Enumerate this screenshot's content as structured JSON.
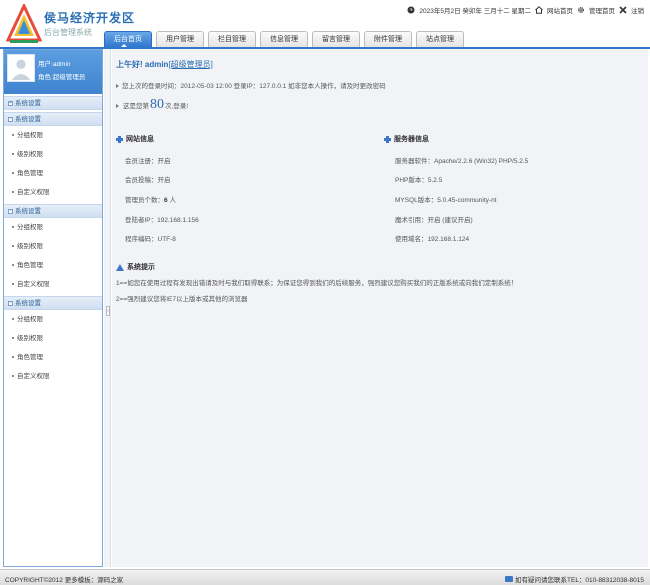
{
  "header": {
    "logo_title": "侯马经济开发区",
    "logo_sub": "后台管理系统",
    "date": "2023年5月2日 癸卯年 三月十二 星期二",
    "site_home": "网站首页",
    "admin_home": "管理首页",
    "logout": "注销"
  },
  "nav": {
    "tabs": [
      "后台首页",
      "用户管理",
      "栏目管理",
      "信息管理",
      "留言管理",
      "附件管理",
      "站点管理"
    ],
    "active_index": 0
  },
  "sidebar": {
    "user_label": "用户:",
    "user_name": "admin",
    "role_label": "角色:",
    "role_name": "超级管理员",
    "groups": [
      {
        "title": "系统设置",
        "expanded": false,
        "items": []
      },
      {
        "title": "系统设置",
        "expanded": true,
        "items": [
          "分组权限",
          "级别权限",
          "角色管理",
          "自定义权限"
        ]
      },
      {
        "title": "系统设置",
        "expanded": true,
        "items": [
          "分组权限",
          "级别权限",
          "角色管理",
          "自定义权限"
        ]
      },
      {
        "title": "系统设置",
        "expanded": true,
        "items": [
          "分组权限",
          "级别权限",
          "角色管理",
          "自定义权限"
        ]
      }
    ]
  },
  "main": {
    "greeting": "上午好! admin",
    "greeting_role": "[超级管理员]",
    "last_login": "您上次的登录时间：2012-05-03 12:00 登录IP：127.0.0.1    如非您本人操作，请及时更改密码",
    "visit_prefix": "这是您第",
    "visit_count": "80",
    "visit_suffix": "次,登录!",
    "site_info_title": "网站信息",
    "site_info": [
      "会员注册：开启",
      "会员投稿：开启",
      "管理员个数：",
      "登陆者IP：192.168.1.156",
      "程序编码：UTF-8"
    ],
    "admin_count": "6",
    "admin_unit": "人",
    "server_info_title": "服务器信息",
    "server_info": [
      "服务器软件：Apache/2.2.6 (Win32) PHP/5.2.5",
      "PHP版本：5.2.5",
      "MYSQL版本：5.0.45-community-nt",
      "魔术引用：开启 (建议开启)",
      "使用域名：192.168.1.124"
    ],
    "tips_title": "系统提示",
    "tips": [
      "1==如您在使用过程有发现出错请及时与我们取得联系；为保证您得到我们的后续服务，强烈建议您购买我们的正版系统或向我们定制系统！",
      "2==强烈建议您将IE7以上版本或其他的浏览器"
    ]
  },
  "footer": {
    "copyright": "COPYRIGHT©2012 更多模板：源码之家",
    "contact": "如有疑问请您联系TEL：010-88312038-8015"
  },
  "colors": {
    "accent": "#2f78cd",
    "sidebar_bg": "#4a8ed8",
    "main_bg": "#f1f3f6"
  }
}
